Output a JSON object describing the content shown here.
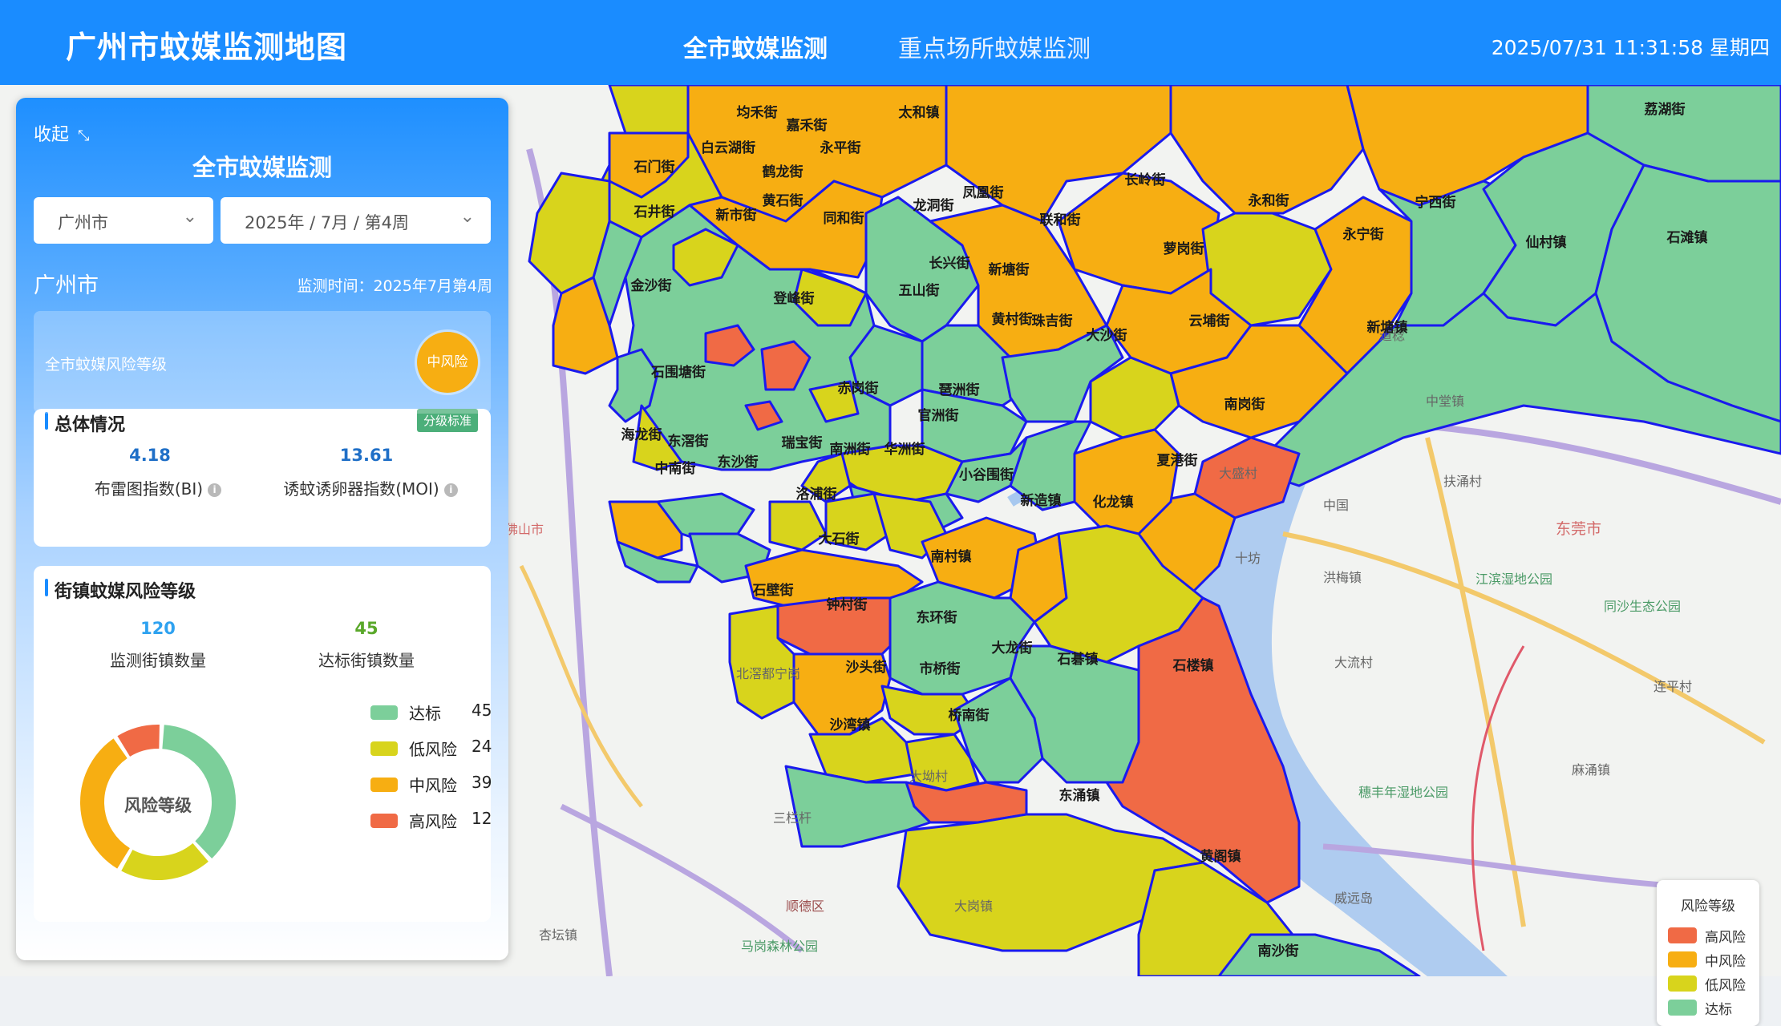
{
  "header": {
    "title": "广州市蚊媒监测地图",
    "tabs": [
      {
        "label": "全市蚊媒监测",
        "active": true
      },
      {
        "label": "重点场所蚊媒监测",
        "active": false
      }
    ],
    "datetime": "2025/07/31 11:31:58 星期四"
  },
  "colors": {
    "accent": "#1a8cff",
    "high_risk": "#f06a45",
    "medium_risk": "#f7ae12",
    "low_risk": "#d8d41c",
    "standard": "#7ccf9a",
    "boundary": "#1a1aee"
  },
  "panel": {
    "collapse_label": "收起",
    "title": "全市蚊媒监测",
    "city_select": "广州市",
    "period_select": "2025年 / 7月 / 第4周",
    "region_name": "广州市",
    "period_text": "监测时间：2025年7月第4周",
    "risk_card": {
      "label": "全市蚊媒风险等级",
      "badge": "中风险"
    },
    "overview": {
      "title": "总体情况",
      "button": "分级标准",
      "bi_value": "4.18",
      "bi_label": "布雷图指数(BI)",
      "moi_value": "13.61",
      "moi_label": "诱蚊诱卵器指数(MOI)"
    },
    "street_risk": {
      "title": "街镇蚊媒风险等级",
      "monitored_value": "120",
      "monitored_label": "监测街镇数量",
      "qualified_value": "45",
      "qualified_label": "达标街镇数量",
      "donut_center": "风险等级",
      "legend": [
        {
          "name": "达标",
          "count": 45,
          "color": "#7ccf9a"
        },
        {
          "name": "低风险",
          "count": 24,
          "color": "#d8d41c"
        },
        {
          "name": "中风险",
          "count": 39,
          "color": "#f7ae12"
        },
        {
          "name": "高风险",
          "count": 12,
          "color": "#f06a45"
        }
      ]
    }
  },
  "map": {
    "districts": [
      {
        "name": "均禾街",
        "risk": "medium"
      },
      {
        "name": "嘉禾街",
        "risk": "low"
      },
      {
        "name": "太和镇",
        "risk": "medium"
      },
      {
        "name": "白云湖街",
        "risk": "medium"
      },
      {
        "name": "永平街",
        "risk": "standard"
      },
      {
        "name": "石门街",
        "risk": "low"
      },
      {
        "name": "鹤龙街",
        "risk": "standard"
      },
      {
        "name": "石井街",
        "risk": "medium"
      },
      {
        "name": "新市街",
        "risk": "standard"
      },
      {
        "name": "黄石街",
        "risk": "standard"
      },
      {
        "name": "同和街",
        "risk": "low"
      },
      {
        "name": "龙洞街",
        "risk": "standard"
      },
      {
        "name": "凤凰街",
        "risk": "standard"
      },
      {
        "name": "联和街",
        "risk": "medium"
      },
      {
        "name": "长岭街",
        "risk": "medium"
      },
      {
        "name": "永和街",
        "risk": "low"
      },
      {
        "name": "永宁街",
        "risk": "medium"
      },
      {
        "name": "宁西街",
        "risk": "standard"
      },
      {
        "name": "荔湖街",
        "risk": "standard"
      },
      {
        "name": "仙村镇",
        "risk": "standard"
      },
      {
        "name": "石滩镇",
        "risk": "standard"
      },
      {
        "name": "新塘镇",
        "risk": "standard"
      },
      {
        "name": "萝岗街",
        "risk": "medium"
      },
      {
        "name": "云埔街",
        "risk": "medium"
      },
      {
        "name": "大沙街",
        "risk": "low"
      },
      {
        "name": "南岗街",
        "risk": "high"
      },
      {
        "name": "夏港街",
        "risk": "medium"
      },
      {
        "name": "长兴街",
        "risk": "standard"
      },
      {
        "name": "五山街",
        "risk": "standard"
      },
      {
        "name": "新塘街",
        "risk": "low"
      },
      {
        "name": "黄村街",
        "risk": "low"
      },
      {
        "name": "珠吉街",
        "risk": "standard"
      },
      {
        "name": "登峰街",
        "risk": "high"
      },
      {
        "name": "金沙街",
        "risk": "standard"
      },
      {
        "name": "石围塘街",
        "risk": "standard"
      },
      {
        "name": "赤岗街",
        "risk": "low"
      },
      {
        "name": "琶洲街",
        "risk": "low"
      },
      {
        "name": "官洲街",
        "risk": "standard"
      },
      {
        "name": "南洲街",
        "risk": "low"
      },
      {
        "name": "华洲街",
        "risk": "low"
      },
      {
        "name": "瑞宝街",
        "risk": "low"
      },
      {
        "name": "海龙街",
        "risk": "medium"
      },
      {
        "name": "东滘街",
        "risk": "standard"
      },
      {
        "name": "中南街",
        "risk": "standard"
      },
      {
        "name": "东沙街",
        "risk": "standard"
      },
      {
        "name": "洛浦街",
        "risk": "medium"
      },
      {
        "name": "小谷围街",
        "risk": "medium"
      },
      {
        "name": "新造镇",
        "risk": "medium"
      },
      {
        "name": "化龙镇",
        "risk": "low"
      },
      {
        "name": "大石街",
        "risk": "high"
      },
      {
        "name": "南村镇",
        "risk": "standard"
      },
      {
        "name": "石壁街",
        "risk": "low"
      },
      {
        "name": "钟村街",
        "risk": "medium"
      },
      {
        "name": "东环街",
        "risk": "low"
      },
      {
        "name": "大龙街",
        "risk": "standard"
      },
      {
        "name": "石碁镇",
        "risk": "standard"
      },
      {
        "name": "石楼镇",
        "risk": "high"
      },
      {
        "name": "沙头街",
        "risk": "low"
      },
      {
        "name": "市桥街",
        "risk": "low"
      },
      {
        "name": "桥南街",
        "risk": "high"
      },
      {
        "name": "沙湾镇",
        "risk": "standard"
      },
      {
        "name": "东涌镇",
        "risk": "low"
      },
      {
        "name": "黄阁镇",
        "risk": "low"
      },
      {
        "name": "南沙街",
        "risk": "standard"
      }
    ],
    "base_labels": [
      "道稔",
      "中堂镇",
      "扶涌村",
      "东莞市",
      "中国",
      "十坊",
      "洪梅镇",
      "江滨湿地公园",
      "同沙生态公园",
      "大流村",
      "连平村",
      "麻涌镇",
      "穗丰年湿地公园",
      "威远岛",
      "大岗镇",
      "北滘都宁岗",
      "大坳村",
      "三栏杆",
      "顺德区",
      "马岗森林公园",
      "杏坛镇",
      "大盛村",
      "佛山市"
    ],
    "legend": {
      "title": "风险等级",
      "items": [
        {
          "name": "高风险",
          "color": "#f06a45"
        },
        {
          "name": "中风险",
          "color": "#f7ae12"
        },
        {
          "name": "低风险",
          "color": "#d8d41c"
        },
        {
          "name": "达标",
          "color": "#7ccf9a"
        }
      ]
    }
  }
}
